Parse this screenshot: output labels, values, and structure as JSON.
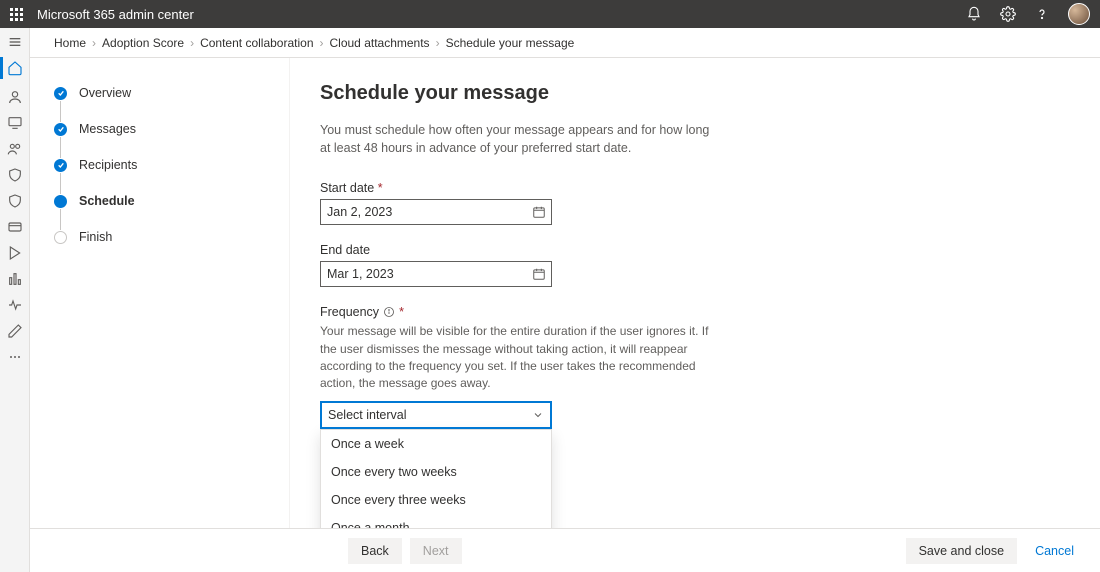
{
  "header": {
    "app_title": "Microsoft 365 admin center"
  },
  "breadcrumb": {
    "items": [
      "Home",
      "Adoption Score",
      "Content collaboration",
      "Cloud attachments",
      "Schedule your message"
    ]
  },
  "wizard": {
    "steps": [
      {
        "label": "Overview",
        "state": "done"
      },
      {
        "label": "Messages",
        "state": "done"
      },
      {
        "label": "Recipients",
        "state": "done"
      },
      {
        "label": "Schedule",
        "state": "current"
      },
      {
        "label": "Finish",
        "state": "pending"
      }
    ]
  },
  "page": {
    "title": "Schedule your message",
    "description": "You must schedule how often your message appears and for how long at least 48 hours in advance of your preferred start date.",
    "start_date": {
      "label": "Start date",
      "value": "Jan 2, 2023",
      "required": true
    },
    "end_date": {
      "label": "End date",
      "value": "Mar 1, 2023",
      "required": false
    },
    "frequency": {
      "label": "Frequency",
      "required": true,
      "description": "Your message will be visible for the entire duration if the user ignores it. If the user dismisses the message without taking action, it will reappear according to the frequency you set. If the user takes the recommended action, the message goes away.",
      "placeholder": "Select interval",
      "options": [
        "Once a week",
        "Once every two weeks",
        "Once every three weeks",
        "Once a month"
      ]
    }
  },
  "footer": {
    "back": "Back",
    "next": "Next",
    "save": "Save and close",
    "cancel": "Cancel"
  }
}
